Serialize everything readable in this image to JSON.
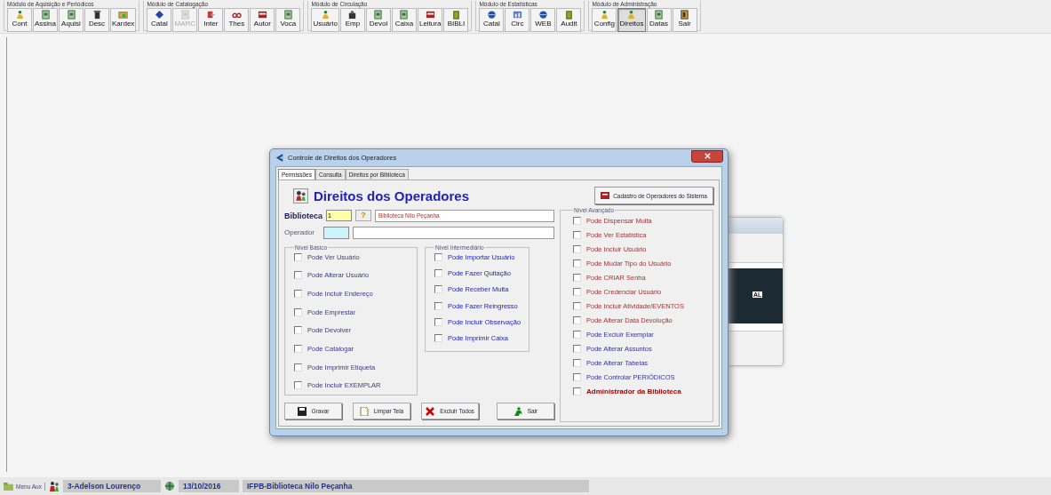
{
  "toolbar": {
    "groups": [
      {
        "title": "Módulo de Aquisição e Periódicos",
        "buttons": [
          {
            "label": "Cont",
            "disabled": false,
            "selected": false
          },
          {
            "label": "Assina",
            "disabled": false,
            "selected": false
          },
          {
            "label": "Aquisi",
            "disabled": false,
            "selected": false
          },
          {
            "label": "Desc",
            "disabled": false,
            "selected": false
          },
          {
            "label": "Kardex",
            "disabled": false,
            "selected": false
          }
        ]
      },
      {
        "title": "Módulo de Catalogação",
        "buttons": [
          {
            "label": "Catal",
            "disabled": false,
            "selected": false
          },
          {
            "label": "MARC",
            "disabled": true,
            "selected": false
          },
          {
            "label": "Inter",
            "disabled": false,
            "selected": false
          },
          {
            "label": "Thes",
            "disabled": false,
            "selected": false
          },
          {
            "label": "Autor",
            "disabled": false,
            "selected": false
          },
          {
            "label": "Voca",
            "disabled": false,
            "selected": false
          }
        ]
      },
      {
        "title": "Módulo de Circulação",
        "buttons": [
          {
            "label": "Usuário",
            "disabled": false,
            "selected": false
          },
          {
            "label": "Emp",
            "disabled": false,
            "selected": false
          },
          {
            "label": "Devol",
            "disabled": false,
            "selected": false
          },
          {
            "label": "Caixa",
            "disabled": false,
            "selected": false
          },
          {
            "label": "Leitura",
            "disabled": false,
            "selected": false
          },
          {
            "label": "BIBLI",
            "disabled": false,
            "selected": false
          }
        ]
      },
      {
        "title": "Módulo de Estatísticas",
        "buttons": [
          {
            "label": "Catal",
            "disabled": false,
            "selected": false
          },
          {
            "label": "Circ",
            "disabled": false,
            "selected": false
          },
          {
            "label": "WEB",
            "disabled": false,
            "selected": false
          },
          {
            "label": "Audit",
            "disabled": false,
            "selected": false
          }
        ]
      },
      {
        "title": "Módulo de Administração",
        "buttons": [
          {
            "label": "Config",
            "disabled": false,
            "selected": false
          },
          {
            "label": "Direitos",
            "disabled": false,
            "selected": true
          },
          {
            "label": "Datas",
            "disabled": false,
            "selected": false
          },
          {
            "label": "Sair",
            "disabled": false,
            "selected": false
          }
        ]
      }
    ]
  },
  "background_window": {
    "text": "AL"
  },
  "dialog": {
    "title": "Controle de Direitos dos Operadores",
    "tabs": [
      {
        "label": "Permissões",
        "selected": true
      },
      {
        "label": "Consulta",
        "selected": false
      },
      {
        "label": "Direitos por Biblioteca",
        "selected": false
      }
    ],
    "heading": "Direitos dos Operadores",
    "register_button": "Cadastro de Operadores do Sistema",
    "library": {
      "label": "Biblioteca",
      "code": "1",
      "help": "?",
      "name": "Biblioteca Nilo Peçanha"
    },
    "operator": {
      "label": "Operador"
    },
    "basic": {
      "title": "Nível Básico",
      "items": [
        {
          "label": "Pode Ver Usuário",
          "checked": false
        },
        {
          "label": "Pode Alterar Usuário",
          "checked": false
        },
        {
          "label": "Pode Incluir Endereço",
          "checked": false
        },
        {
          "label": "Pode Emprestar",
          "checked": false
        },
        {
          "label": "Pode Devolver",
          "checked": false
        },
        {
          "label": "Pode Catalogar",
          "checked": false
        },
        {
          "label": "Pode Imprimir Etiqueta",
          "checked": false
        },
        {
          "label": "Pode Incluir EXEMPLAR",
          "checked": false
        }
      ]
    },
    "intermediate": {
      "title": "Nível Intermediário",
      "items": [
        {
          "label": "Pode Importar Usuário",
          "checked": false
        },
        {
          "label": "Pode Fazer Quitação",
          "checked": false
        },
        {
          "label": "Pode Receber Multa",
          "checked": false
        },
        {
          "label": "Pode Fazer Reingresso",
          "checked": false
        },
        {
          "label": "Pode Incluir Observação",
          "checked": false
        },
        {
          "label": "Pode Imprimir Caixa",
          "checked": false
        }
      ]
    },
    "advanced": {
      "title": "Nível Avançado",
      "items": [
        {
          "label": "Pode Dispensar Multa",
          "checked": false,
          "kind": "reddish"
        },
        {
          "label": "Pode Ver Estatística",
          "checked": false,
          "kind": "reddish"
        },
        {
          "label": "Pode Incluir Usuário",
          "checked": false,
          "kind": "reddish"
        },
        {
          "label": "Pode Mudar Tipo do Usuário",
          "checked": false,
          "kind": "reddish"
        },
        {
          "label": "Pode CRIAR Senha",
          "checked": false,
          "kind": "reddish"
        },
        {
          "label": "Pode Credenciar Usuário",
          "checked": false,
          "kind": "reddish"
        },
        {
          "label": "Pode Incluir Atividade/EVENTOS",
          "checked": false,
          "kind": "reddish"
        },
        {
          "label": "Pode Alterar Data Devolução",
          "checked": false,
          "kind": "reddish"
        },
        {
          "label": "Pode Excluir Exemplar",
          "checked": false,
          "kind": "bluish"
        },
        {
          "label": "Pode Alterar Assuntos",
          "checked": false,
          "kind": "bluish"
        },
        {
          "label": "Pode Alterar Tabelas",
          "checked": false,
          "kind": "bluish"
        },
        {
          "label": "Pode Controlar PERIÓDICOS",
          "checked": false,
          "kind": "bluish"
        },
        {
          "label": "Administrador da Biblioteca",
          "checked": false,
          "kind": "admin"
        }
      ]
    },
    "buttons": [
      {
        "label": "Gravar",
        "kind": "save"
      },
      {
        "label": "Limpar Tela",
        "kind": "clear"
      },
      {
        "label": "Excluir Todos",
        "kind": "delete"
      },
      {
        "label": "Sair",
        "kind": "exit"
      }
    ]
  },
  "status_bar": {
    "menu": "Menu Aux",
    "user": "3-Adelson Lourenço",
    "date": "13/10/2016",
    "library": "IFPB-Biblioteca Nilo Peçanha"
  }
}
